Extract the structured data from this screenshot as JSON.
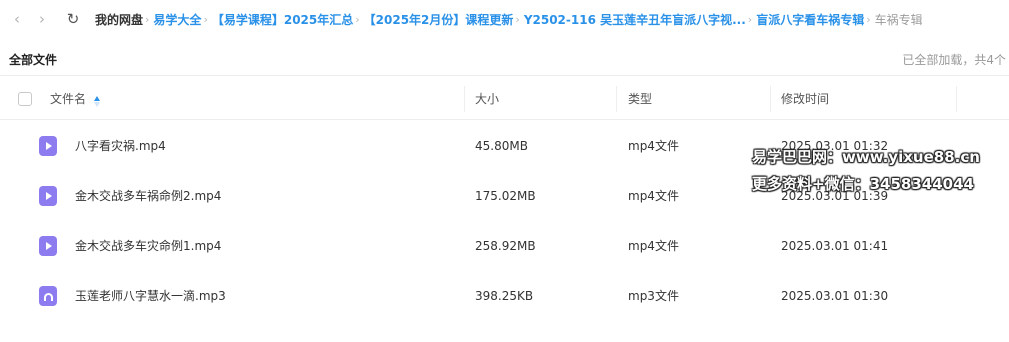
{
  "toolbar": {
    "back_icon": "chevron-left-icon",
    "forward_icon": "chevron-right-icon",
    "refresh_icon": "refresh-icon"
  },
  "breadcrumb": {
    "items": [
      "我的网盘",
      "易学大全",
      "【易学课程】2025年汇总",
      "【2025年2月份】课程更新",
      "Y2502-116 吴玉莲辛丑年盲派八字视...",
      "盲派八字看车祸专辑",
      "车祸专辑"
    ],
    "separator": "›"
  },
  "section": {
    "title": "全部文件",
    "status": "已全部加载，共4个"
  },
  "table": {
    "headers": {
      "name": "文件名",
      "size": "大小",
      "type": "类型",
      "modified": "修改时间"
    },
    "sorted_column": "name",
    "rows": [
      {
        "name": "八字看灾祸.mp4",
        "size": "45.80MB",
        "type": "mp4文件",
        "modified": "2025.03.01 01:32",
        "icon": "video-file-icon"
      },
      {
        "name": "金木交战多车祸命例2.mp4",
        "size": "175.02MB",
        "type": "mp4文件",
        "modified": "2025.03.01 01:39",
        "icon": "video-file-icon"
      },
      {
        "name": "金木交战多车灾命例1.mp4",
        "size": "258.92MB",
        "type": "mp4文件",
        "modified": "2025.03.01 01:41",
        "icon": "video-file-icon"
      },
      {
        "name": "玉莲老师八字慧水一滴.mp3",
        "size": "398.25KB",
        "type": "mp3文件",
        "modified": "2025.03.01 01:30",
        "icon": "audio-file-icon"
      }
    ]
  },
  "watermark": {
    "line1": "易学巴巴网：www.yixue88.cn",
    "line2": "更多资料+微信：3458344044"
  },
  "colors": {
    "accent": "#2a91e8",
    "file_icon": "#8c7cf0",
    "muted": "#999999"
  }
}
